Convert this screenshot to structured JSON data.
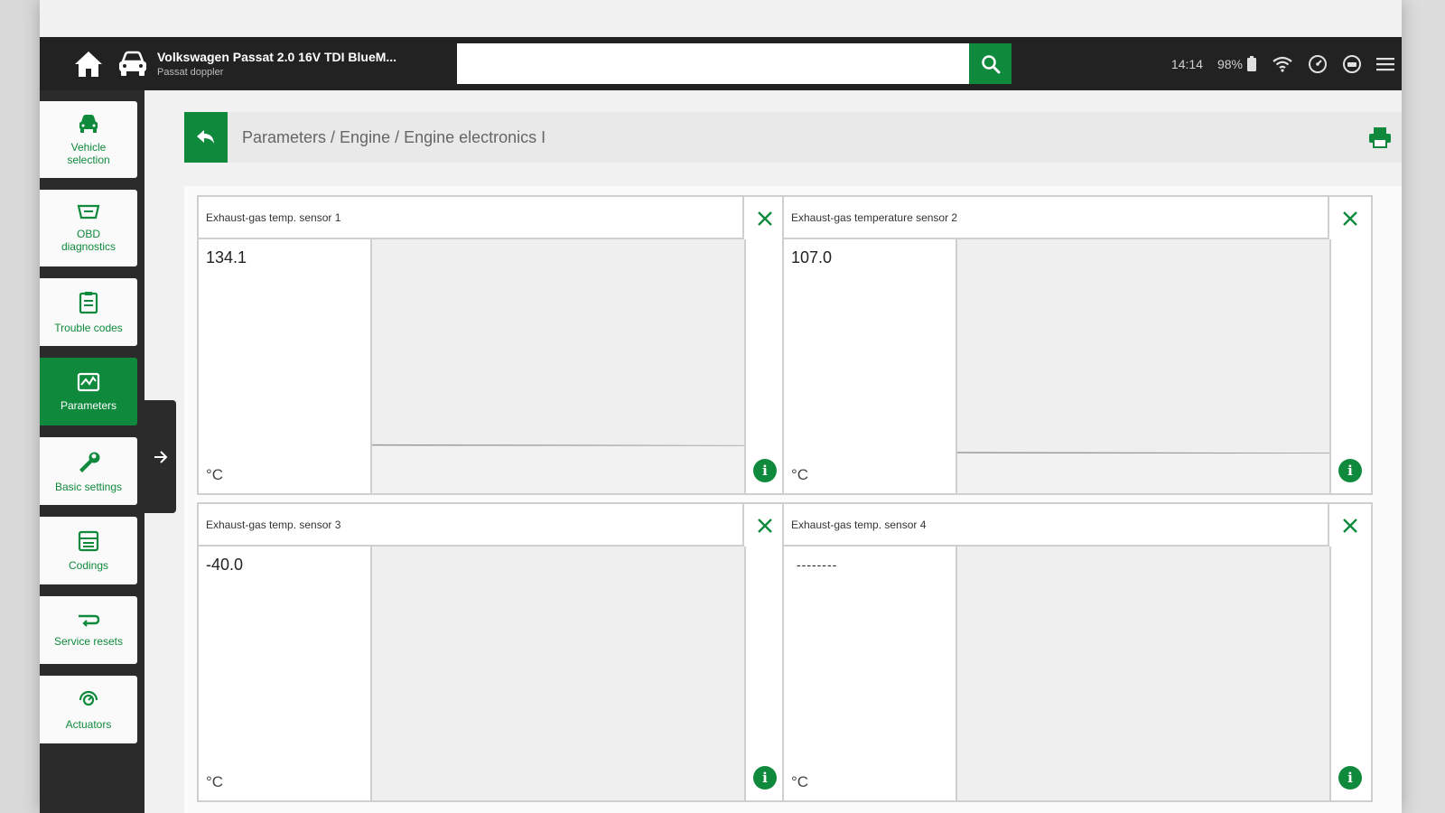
{
  "vehicle": {
    "title": "Volkswagen Passat 2.0 16V TDI BlueM...",
    "subtitle": "Passat doppler"
  },
  "search": {
    "value": "",
    "placeholder": ""
  },
  "status": {
    "time": "14:14",
    "battery": "98%"
  },
  "sidebar": {
    "items": [
      {
        "label": "Vehicle selection",
        "icon": "car-icon",
        "active": false
      },
      {
        "label": "OBD diagnostics",
        "icon": "obd-icon",
        "active": false
      },
      {
        "label": "Trouble codes",
        "icon": "clipboard-icon",
        "active": false
      },
      {
        "label": "Parameters",
        "icon": "chart-icon",
        "active": true
      },
      {
        "label": "Basic settings",
        "icon": "wrench-icon",
        "active": false
      },
      {
        "label": "Codings",
        "icon": "codings-icon",
        "active": false
      },
      {
        "label": "Service resets",
        "icon": "reset-icon",
        "active": false
      },
      {
        "label": "Actuators",
        "icon": "actuator-icon",
        "active": false
      }
    ]
  },
  "breadcrumb": "Parameters / Engine / Engine electronics I",
  "tiles": [
    {
      "title": "Exhaust-gas temp. sensor 1",
      "value": "134.1",
      "unit": "°C",
      "level": 0.19
    },
    {
      "title": "Exhaust-gas temperature sensor 2",
      "value": "107.0",
      "unit": "°C",
      "level": 0.16
    },
    {
      "title": "Exhaust-gas temp. sensor 3",
      "value": "-40.0",
      "unit": "°C",
      "level": null
    },
    {
      "title": "Exhaust-gas temp. sensor 4",
      "value": "--------",
      "unit": "°C",
      "level": null
    }
  ],
  "colors": {
    "accent": "#0f8a3c",
    "topbar": "#222222",
    "sidebar": "#2b2b2b"
  }
}
